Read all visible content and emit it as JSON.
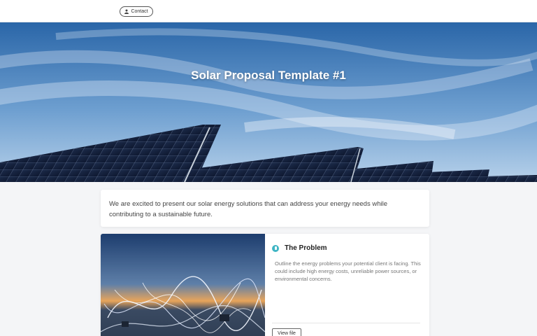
{
  "topbar": {
    "contact_label": "Contact",
    "contact_icon": "person-icon"
  },
  "hero": {
    "title": "Solar Proposal Template #1"
  },
  "intro": {
    "text": "We are excited to present our solar energy solutions that can address your energy needs while contributing to a sustainable future."
  },
  "section": {
    "icon": "document-icon",
    "title": "The Problem",
    "text": "Outline the energy problems your potential client is facing. This could include high energy costs, unreliable power sources, or environmental concerns.",
    "view_label": "View file"
  },
  "colors": {
    "accent": "#3fb5c4",
    "sky_top": "#2f6fb0",
    "sky_bottom": "#a9c9e6"
  }
}
